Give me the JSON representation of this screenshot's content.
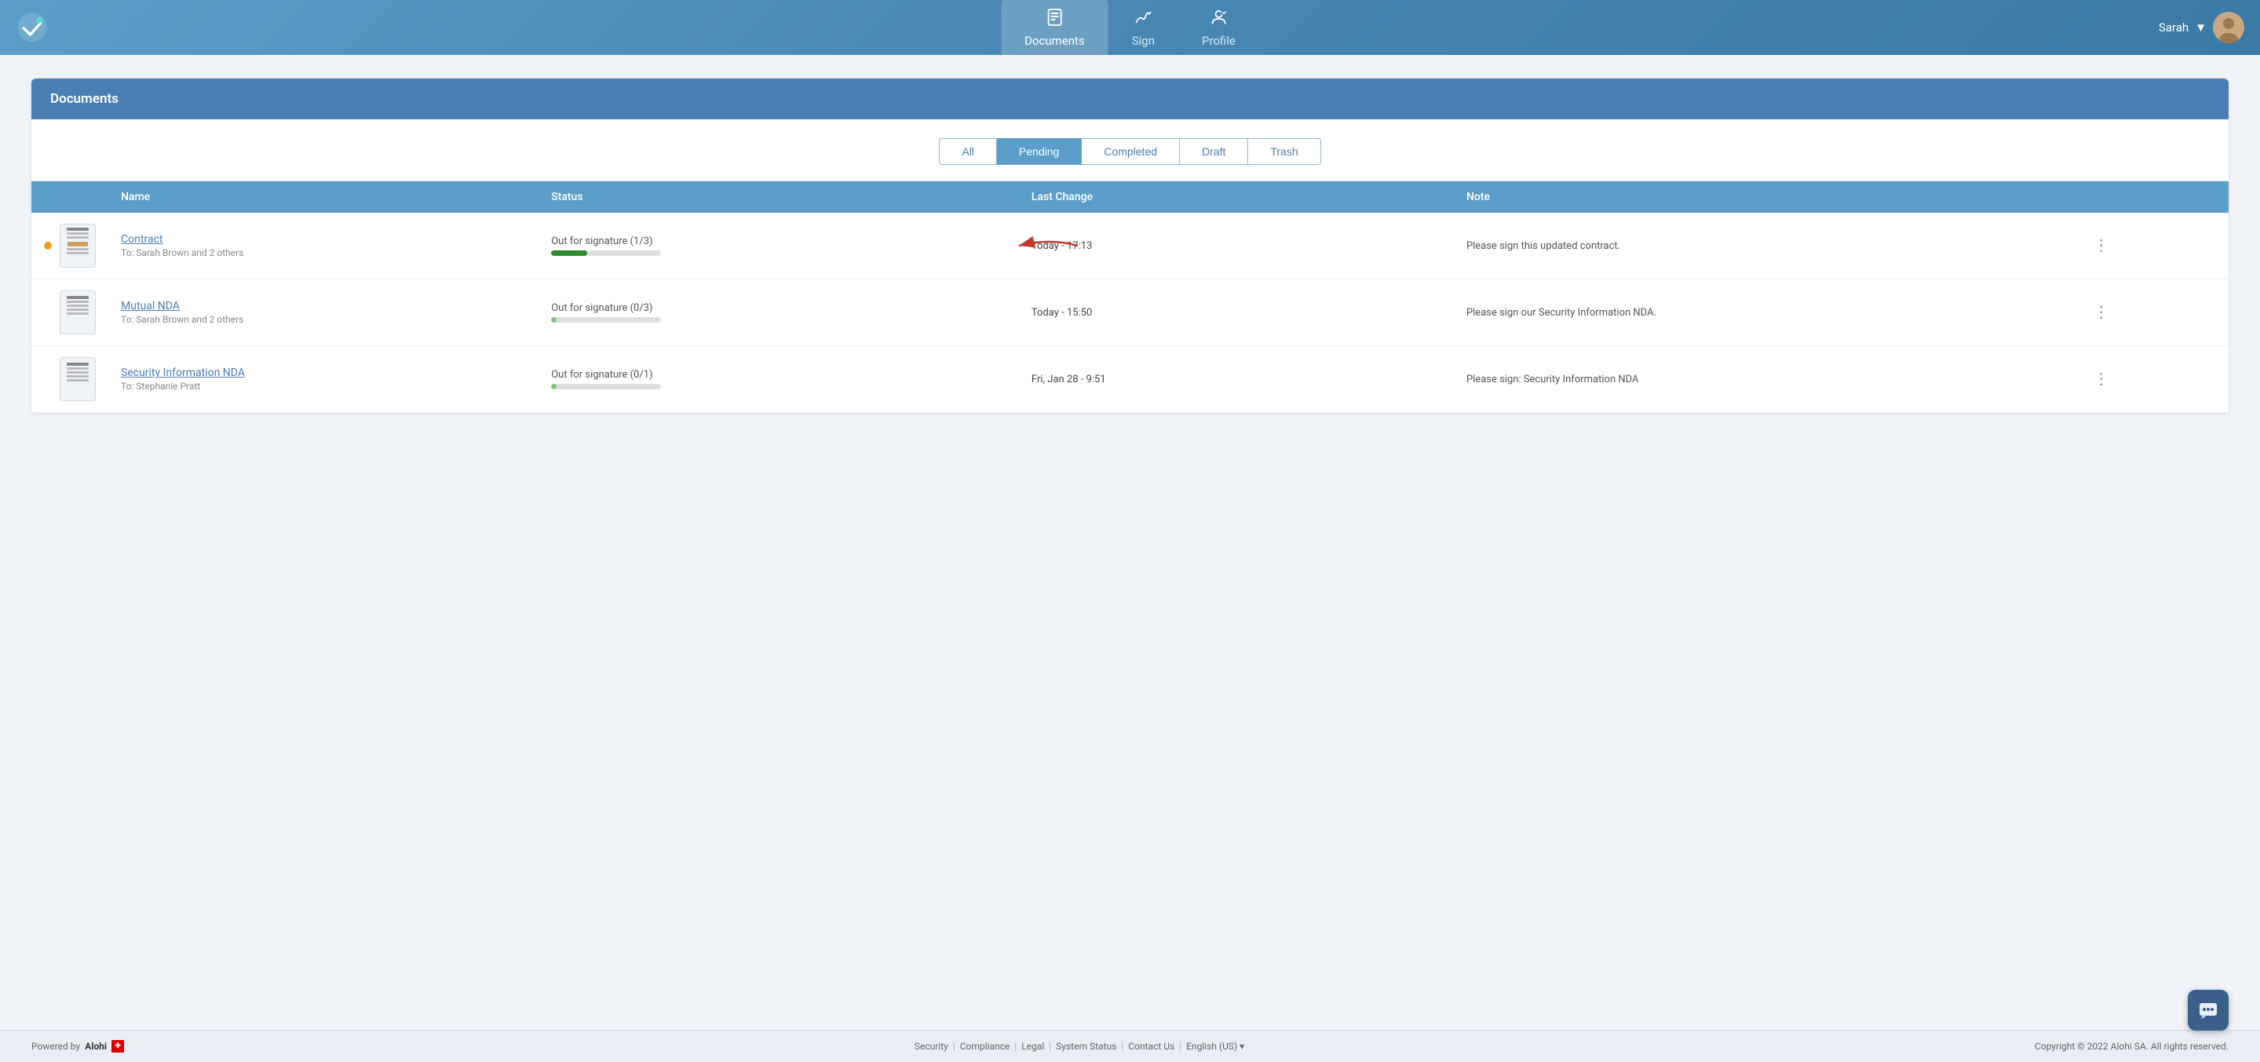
{
  "header": {
    "nav_items": [
      {
        "id": "documents",
        "label": "Documents",
        "active": true
      },
      {
        "id": "sign",
        "label": "Sign",
        "active": false
      },
      {
        "id": "profile",
        "label": "Profile",
        "active": false
      }
    ],
    "user_name": "Sarah",
    "user_dropdown": "▼"
  },
  "panel": {
    "title": "Documents",
    "filters": [
      {
        "id": "all",
        "label": "All",
        "active": false
      },
      {
        "id": "pending",
        "label": "Pending",
        "active": true
      },
      {
        "id": "completed",
        "label": "Completed",
        "active": false
      },
      {
        "id": "draft",
        "label": "Draft",
        "active": false
      },
      {
        "id": "trash",
        "label": "Trash",
        "active": false
      }
    ],
    "table": {
      "columns": [
        "",
        "Name",
        "Status",
        "Last Change",
        "Note",
        ""
      ],
      "rows": [
        {
          "id": "contract",
          "has_dot": true,
          "name": "Contract",
          "recipient": "To: Sarah Brown and 2 others",
          "status_text": "Out for signature (1/3)",
          "progress": 33,
          "progress_style": "dark-green",
          "last_change": "Today - 17:13",
          "note": "Please sign this updated contract.",
          "has_arrow": true
        },
        {
          "id": "mutual-nda",
          "has_dot": false,
          "name": "Mutual NDA",
          "recipient": "To: Sarah Brown and 2 others",
          "status_text": "Out for signature (0/3)",
          "progress": 5,
          "progress_style": "light-green",
          "last_change": "Today - 15:50",
          "note": "Please sign our Security Information NDA.",
          "has_arrow": false
        },
        {
          "id": "security-nda",
          "has_dot": false,
          "name": "Security Information NDA",
          "recipient": "To: Stephanie Pratt",
          "status_text": "Out for signature (0/1)",
          "progress": 5,
          "progress_style": "light-green",
          "last_change": "Fri, Jan 28 - 9:51",
          "note": "Please sign: Security Information NDA",
          "has_arrow": false
        }
      ]
    }
  },
  "footer": {
    "powered_by": "Powered by",
    "brand": "Alohi",
    "links": [
      "Security",
      "Compliance",
      "Legal",
      "System Status",
      "Contact Us",
      "English (US) ▾"
    ],
    "copyright": "Copyright © 2022 Alohi SA. All rights reserved."
  },
  "chat": {
    "icon": "💬"
  }
}
